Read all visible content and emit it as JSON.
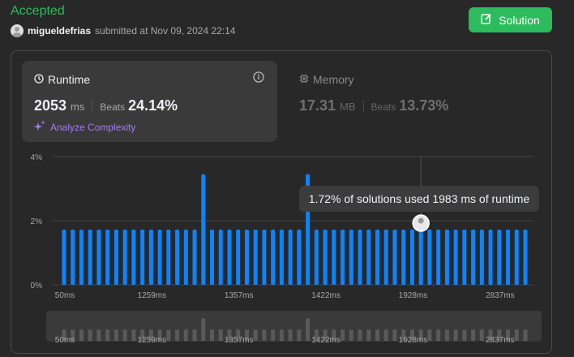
{
  "status": "Accepted",
  "user": {
    "name": "migueldefrias",
    "submitted": "submitted at Nov 09, 2024 22:14"
  },
  "solution_button": "Solution",
  "runtime": {
    "title": "Runtime",
    "value": "2053",
    "unit": "ms",
    "beats_label": "Beats",
    "beats_pct": "24.14%",
    "analyze": "Analyze Complexity"
  },
  "memory": {
    "title": "Memory",
    "value": "17.31",
    "unit": "MB",
    "beats_label": "Beats",
    "beats_pct": "13.73%"
  },
  "tooltip": "1.72% of solutions used 1983 ms of runtime",
  "colors": {
    "accent": "#2cbb5d",
    "bar": "#0a84ff",
    "bar_muted": "#5a5a5a",
    "analyze": "#a47bf0"
  },
  "chart_data": {
    "type": "bar",
    "ylabel_ticks": [
      "4%",
      "2%",
      "0%"
    ],
    "ylim": [
      0,
      4
    ],
    "x_tick_labels": [
      "50ms",
      "1259ms",
      "1357ms",
      "1422ms",
      "1928ms",
      "2837ms"
    ],
    "values": [
      1.72,
      1.72,
      1.72,
      1.72,
      1.72,
      1.72,
      1.72,
      1.72,
      1.72,
      1.72,
      1.72,
      1.72,
      1.72,
      1.72,
      1.72,
      1.72,
      3.45,
      1.72,
      1.72,
      1.72,
      1.72,
      1.72,
      1.72,
      1.72,
      1.72,
      1.72,
      1.72,
      1.72,
      3.45,
      1.72,
      1.72,
      1.72,
      1.72,
      1.72,
      1.72,
      1.72,
      1.72,
      1.72,
      1.72,
      1.72,
      1.72,
      1.72,
      1.72,
      1.72,
      1.72,
      1.72,
      1.72,
      1.72,
      1.72,
      1.72,
      1.72,
      1.72,
      1.72,
      1.72
    ],
    "highlight_index": 41,
    "grid": true
  }
}
